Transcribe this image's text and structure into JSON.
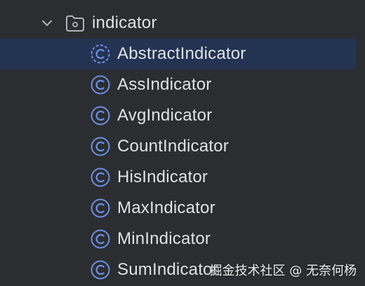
{
  "colors": {
    "background": "#2b2d30",
    "selection": "#233352",
    "text": "#dfe1e5",
    "class_icon": "#6c8fe6",
    "icon_stroke": "#aeb3c2"
  },
  "tree": {
    "folder": {
      "label": "indicator",
      "icon": "folder-icon",
      "expanded": true
    },
    "items": [
      {
        "label": "AbstractIndicator",
        "icon": "abstract-class-icon",
        "selected": true
      },
      {
        "label": "AssIndicator",
        "icon": "class-icon",
        "selected": false
      },
      {
        "label": "AvgIndicator",
        "icon": "class-icon",
        "selected": false
      },
      {
        "label": "CountIndicator",
        "icon": "class-icon",
        "selected": false
      },
      {
        "label": "HisIndicator",
        "icon": "class-icon",
        "selected": false
      },
      {
        "label": "MaxIndicator",
        "icon": "class-icon",
        "selected": false
      },
      {
        "label": "MinIndicator",
        "icon": "class-icon",
        "selected": false
      },
      {
        "label": "SumIndicator",
        "icon": "class-icon",
        "selected": false
      }
    ]
  },
  "watermark": {
    "text": "掘金技术社区 @ 无奈何杨"
  }
}
